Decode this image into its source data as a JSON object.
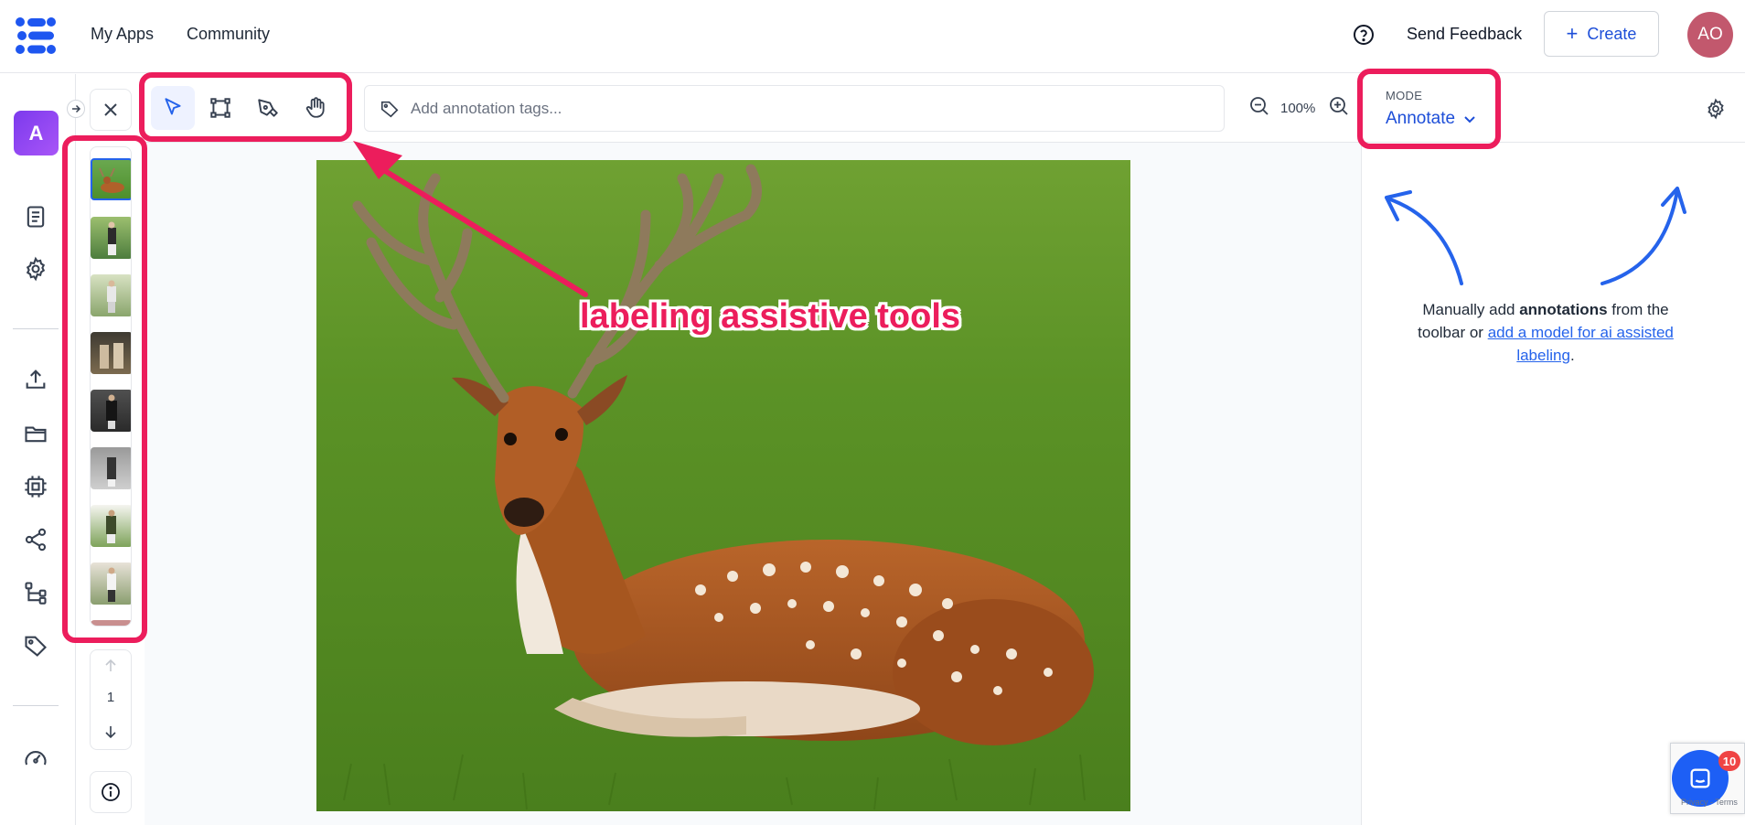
{
  "topbar": {
    "nav": [
      "My Apps",
      "Community"
    ],
    "send_feedback": "Send Feedback",
    "create_label": "Create",
    "avatar_initials": "AO"
  },
  "rail": {
    "app_badge": "A",
    "icons": [
      "document-icon",
      "settings-icon",
      "upload-icon",
      "folder-icon",
      "cpu-icon",
      "share-icon",
      "workflow-icon",
      "tag-icon",
      "dashboard-gauge-icon"
    ]
  },
  "thumbnails": {
    "count_visible": 8,
    "selected_index": 0,
    "page_number": "1"
  },
  "toolbar": {
    "tools": [
      "select-tool",
      "bounding-box-tool",
      "polygon-pen-tool",
      "pan-hand-tool"
    ],
    "active_tool": "select-tool",
    "tag_placeholder": "Add annotation tags...",
    "zoom_level": "100%"
  },
  "right_panel": {
    "mode_label": "MODE",
    "mode_value": "Annotate",
    "hint_prefix": "Manually add ",
    "hint_bold": "annotations",
    "hint_middle": " from the toolbar or ",
    "hint_link": "add a model for ai assisted labeling",
    "hint_suffix": "."
  },
  "annotation": {
    "callout_text": "labeling assistive tools",
    "highlight_color": "#ec1d5c",
    "arrow_color": "#2563eb"
  },
  "widgets": {
    "chat_badge_count": "10",
    "recaptcha_text": "Privacy - Terms"
  },
  "colors": {
    "accent": "#1d4ed8",
    "avatar": "#c2586d",
    "app_badge": "#8b5cf6"
  }
}
